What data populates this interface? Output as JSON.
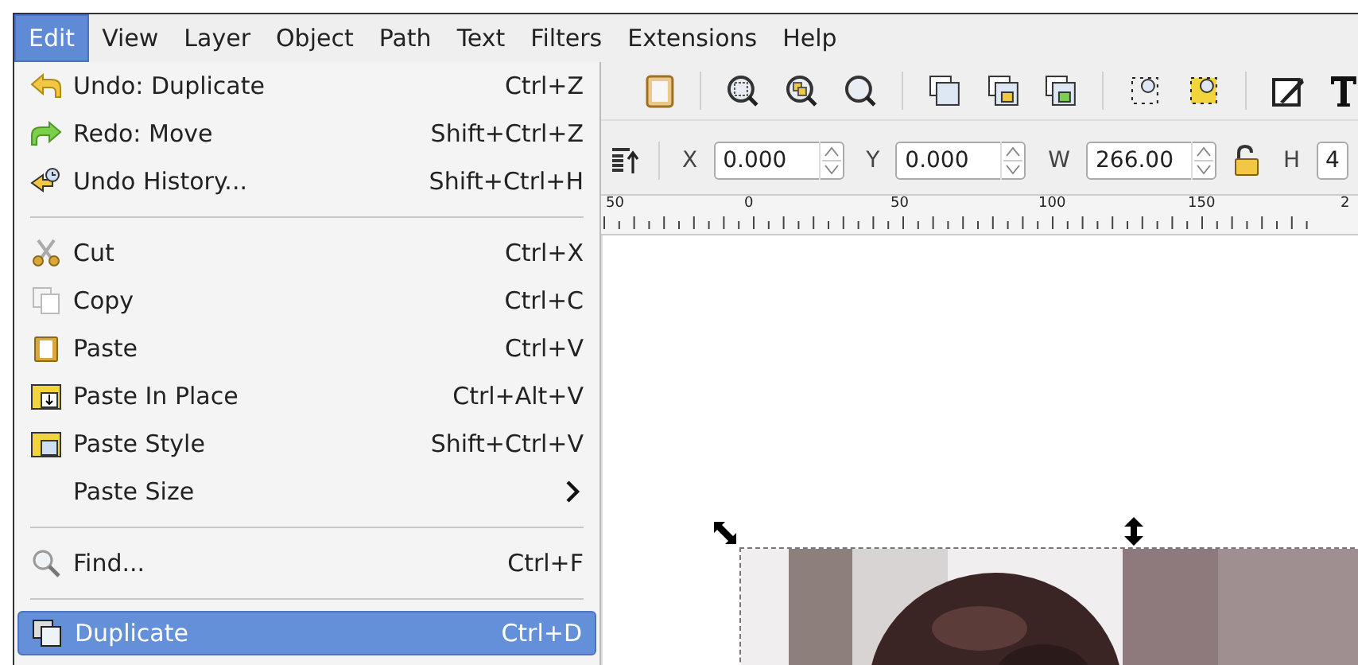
{
  "menubar": [
    {
      "label": "Edit",
      "selected": true
    },
    {
      "label": "View",
      "selected": false
    },
    {
      "label": "Layer",
      "selected": false
    },
    {
      "label": "Object",
      "selected": false
    },
    {
      "label": "Path",
      "selected": false
    },
    {
      "label": "Text",
      "selected": false
    },
    {
      "label": "Filters",
      "selected": false
    },
    {
      "label": "Extensions",
      "selected": false
    },
    {
      "label": "Help",
      "selected": false
    }
  ],
  "edit_menu": [
    {
      "kind": "item",
      "label": "Undo: Duplicate",
      "shortcut": "Ctrl+Z",
      "selected": false
    },
    {
      "kind": "item",
      "label": "Redo: Move",
      "shortcut": "Shift+Ctrl+Z",
      "selected": false
    },
    {
      "kind": "item",
      "label": "Undo History...",
      "shortcut": "Shift+Ctrl+H",
      "selected": false
    },
    {
      "kind": "separator"
    },
    {
      "kind": "item",
      "label": "Cut",
      "shortcut": "Ctrl+X",
      "selected": false
    },
    {
      "kind": "item",
      "label": "Copy",
      "shortcut": "Ctrl+C",
      "selected": false
    },
    {
      "kind": "item",
      "label": "Paste",
      "shortcut": "Ctrl+V",
      "selected": false
    },
    {
      "kind": "item",
      "label": "Paste In Place",
      "shortcut": "Ctrl+Alt+V",
      "selected": false
    },
    {
      "kind": "item",
      "label": "Paste Style",
      "shortcut": "Shift+Ctrl+V",
      "selected": false
    },
    {
      "kind": "submenu",
      "label": "Paste Size",
      "selected": false
    },
    {
      "kind": "separator"
    },
    {
      "kind": "item",
      "label": "Find...",
      "shortcut": "Ctrl+F",
      "selected": false
    },
    {
      "kind": "separator"
    },
    {
      "kind": "item",
      "label": "Duplicate",
      "shortcut": "Ctrl+D",
      "selected": true
    }
  ],
  "toolbar_fields": [
    {
      "label": "X",
      "value": "0.000"
    },
    {
      "label": "Y",
      "value": "0.000"
    },
    {
      "label": "W",
      "value": "266.00"
    },
    {
      "label": "H",
      "value": "4"
    }
  ],
  "ruler": [
    "50",
    "0",
    "50",
    "100",
    "150",
    "2"
  ]
}
